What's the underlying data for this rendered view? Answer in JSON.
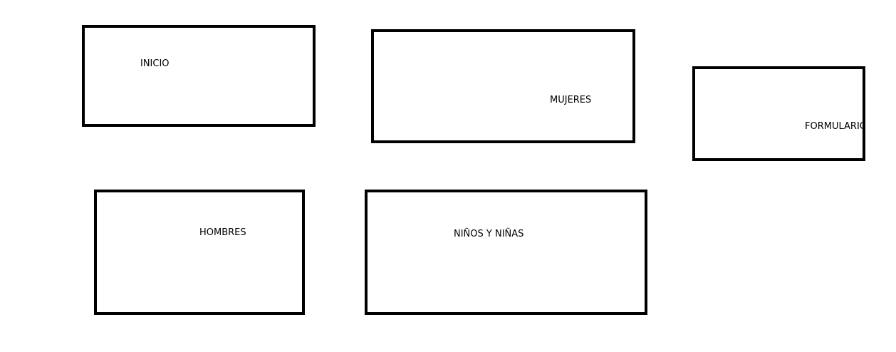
{
  "boxes": {
    "inicio": {
      "label": "INICIO"
    },
    "mujeres": {
      "label": "MUJERES"
    },
    "formulario": {
      "label": "FORMULARIO"
    },
    "hombres": {
      "label": "HOMBRES"
    },
    "ninos": {
      "label": "NIÑOS Y NIÑAS"
    }
  },
  "colors": {
    "border": "#000000",
    "background": "#ffffff",
    "text": "#000000"
  }
}
